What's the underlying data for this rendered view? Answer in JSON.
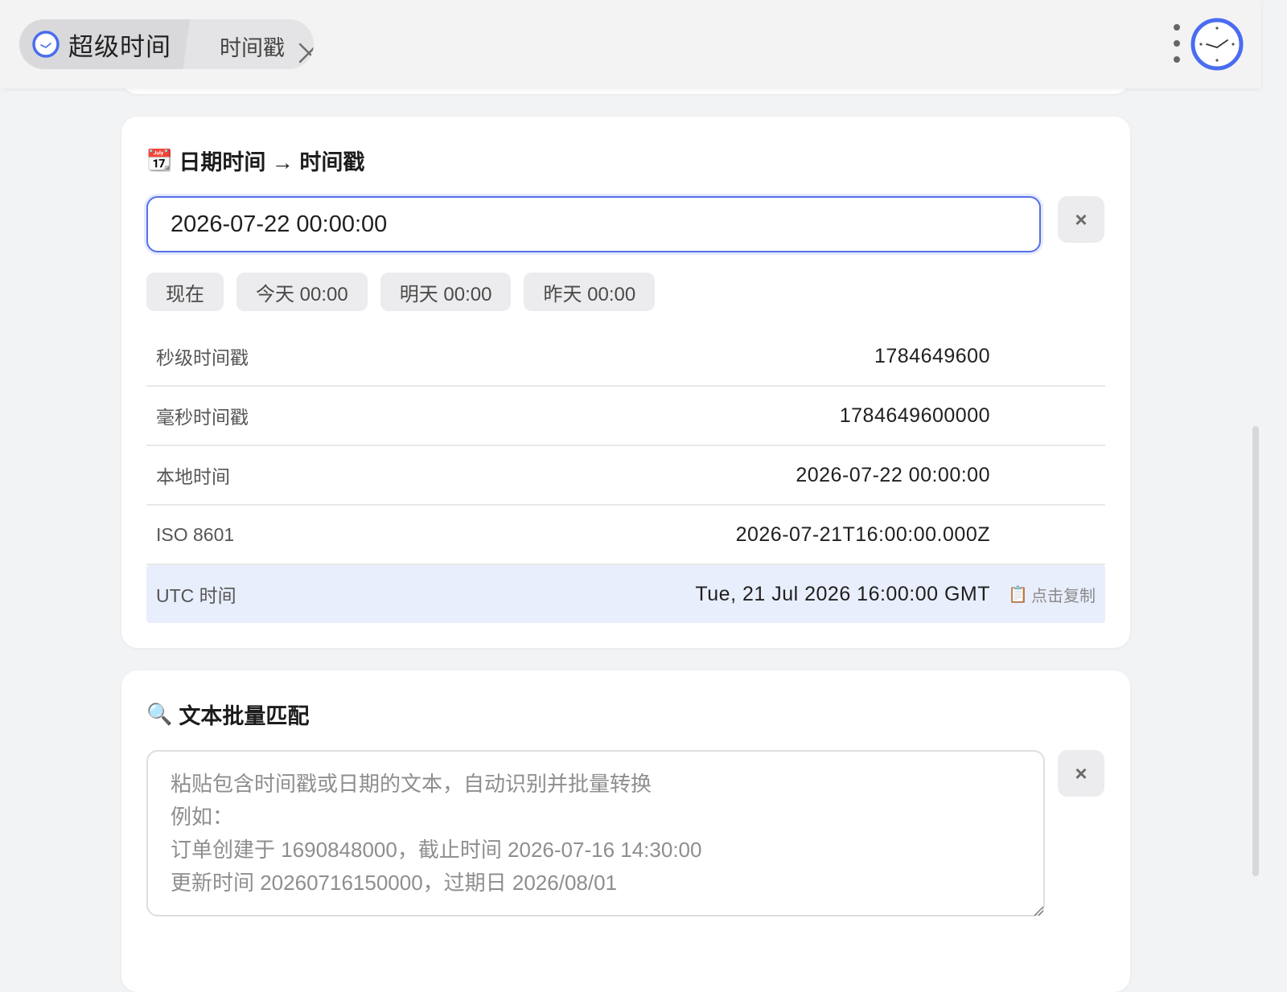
{
  "tabs": {
    "app_title": "超级时间",
    "current_tab": "时间戳"
  },
  "datetime_card": {
    "emoji": "📆",
    "title": "日期时间 → 时间戳",
    "input_value": "2026-07-22 00:00:00",
    "clear_label": "×",
    "quick_buttons": [
      "现在",
      "今天 00:00",
      "明天 00:00",
      "昨天 00:00"
    ],
    "results": [
      {
        "label": "秒级时间戳",
        "value": "1784649600"
      },
      {
        "label": "毫秒时间戳",
        "value": "1784649600000"
      },
      {
        "label": "本地时间",
        "value": "2026-07-22 00:00:00"
      },
      {
        "label": "ISO 8601",
        "value": "2026-07-21T16:00:00.000Z"
      },
      {
        "label": "UTC 时间",
        "value": "Tue, 21 Jul 2026 16:00:00 GMT",
        "copy_icon": "📋",
        "copy_label": "点击复制"
      }
    ]
  },
  "batch_card": {
    "emoji": "🔍",
    "title": "文本批量匹配",
    "placeholder": "粘贴包含时间戳或日期的文本，自动识别并批量转换\n例如：\n订单创建于 1690848000，截止时间 2026-07-16 14:30:00\n更新时间 20260716150000，过期日 2026/08/01",
    "clear_label": "×"
  },
  "colors": {
    "accent": "#5570e8",
    "highlight_row": "#e9eefc",
    "background": "#f2f3f5"
  }
}
